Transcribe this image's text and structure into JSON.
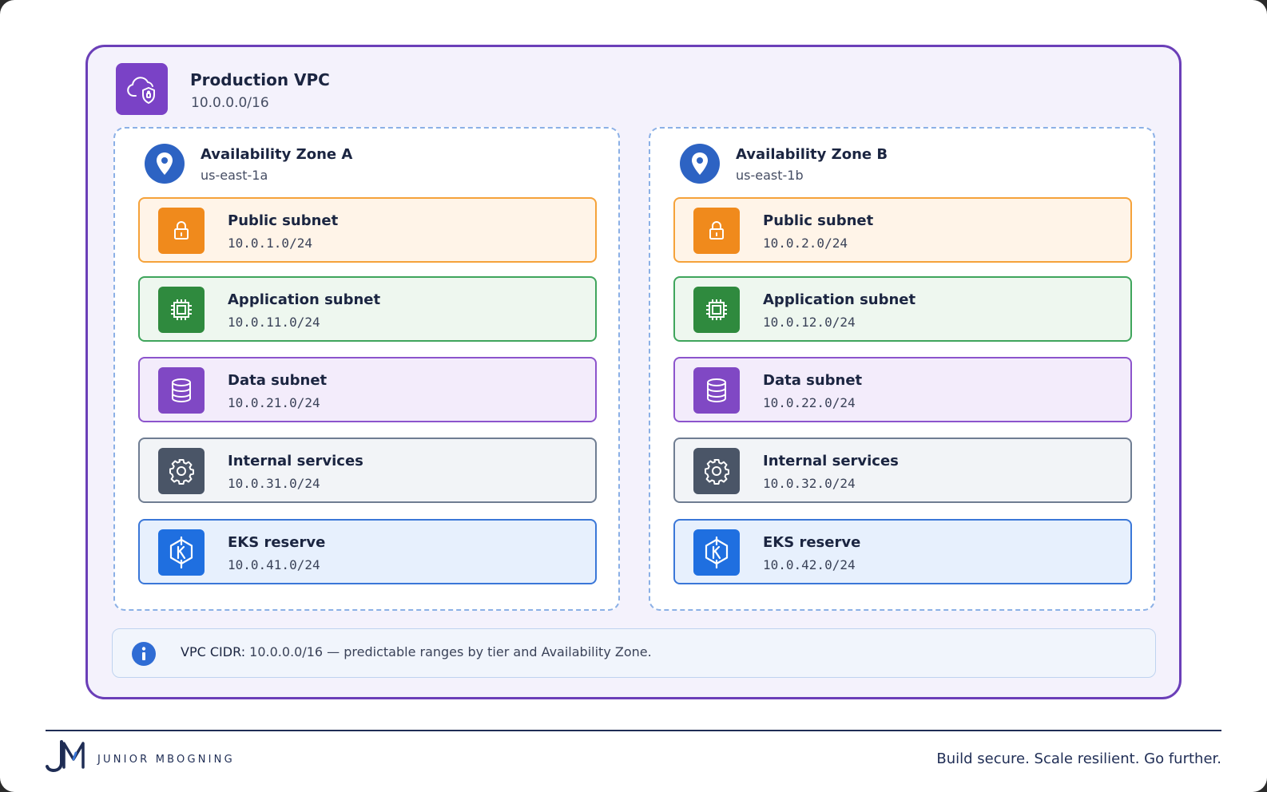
{
  "vpc": {
    "title": "Production VPC",
    "cidr": "10.0.0.0/16",
    "icon": "cloud-shield-icon"
  },
  "zones": [
    {
      "title": "Availability Zone A",
      "region": "us-east-1a",
      "subnets": [
        {
          "name": "Public subnet",
          "cidr": "10.0.1.0/24",
          "icon": "lock-icon"
        },
        {
          "name": "Application subnet",
          "cidr": "10.0.11.0/24",
          "icon": "chip-icon"
        },
        {
          "name": "Data subnet",
          "cidr": "10.0.21.0/24",
          "icon": "database-icon"
        },
        {
          "name": "Internal services",
          "cidr": "10.0.31.0/24",
          "icon": "gear-icon"
        },
        {
          "name": "EKS reserve",
          "cidr": "10.0.41.0/24",
          "icon": "kubernetes-icon"
        }
      ]
    },
    {
      "title": "Availability Zone B",
      "region": "us-east-1b",
      "subnets": [
        {
          "name": "Public subnet",
          "cidr": "10.0.2.0/24",
          "icon": "lock-icon"
        },
        {
          "name": "Application subnet",
          "cidr": "10.0.12.0/24",
          "icon": "chip-icon"
        },
        {
          "name": "Data subnet",
          "cidr": "10.0.22.0/24",
          "icon": "database-icon"
        },
        {
          "name": "Internal services",
          "cidr": "10.0.32.0/24",
          "icon": "gear-icon"
        },
        {
          "name": "EKS reserve",
          "cidr": "10.0.42.0/24",
          "icon": "kubernetes-icon"
        }
      ]
    }
  ],
  "info": {
    "label": "VPC CIDR:",
    "cidr": "10.0.0.0/16",
    "dash": "—",
    "text": "predictable ranges by tier and Availability Zone."
  },
  "footer": {
    "brand": "JUNIOR MBOGNING",
    "tagline": "Build secure. Scale resilient. Go further."
  },
  "colors": {
    "vpc_border": "#6b3fb8",
    "public": "#f08a1c",
    "application": "#2f8a3e",
    "data": "#8048c4",
    "internal": "#4a5567",
    "eks": "#1f6fe0",
    "zone_pin": "#2d63c3"
  }
}
